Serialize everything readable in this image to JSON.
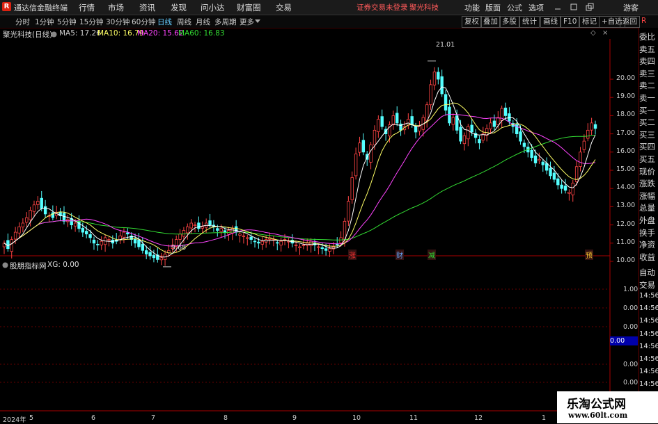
{
  "app": {
    "name": "通达信金融终端",
    "logo_char": "R",
    "warning": "证券交易未登录",
    "stock_tag": "聚光科技"
  },
  "menu": [
    "行情",
    "市场",
    "资讯",
    "发现",
    "问小达",
    "财富圈",
    "交易"
  ],
  "right_menu": [
    "功能",
    "版面",
    "公式",
    "选项"
  ],
  "login": "游客",
  "periods": [
    "分时",
    "1分钟",
    "5分钟",
    "15分钟",
    "30分钟",
    "60分钟",
    "日线",
    "周线",
    "月线",
    "多周期",
    "更多"
  ],
  "active_period": "日线",
  "tool_buttons": [
    "复权",
    "叠加",
    "多股",
    "统计",
    "画线",
    "F10",
    "标记",
    "+自选",
    "返回"
  ],
  "stock_title": "聚光科技(日线)",
  "ma": [
    {
      "label": "MA5: 17.26",
      "color": "#ffffff"
    },
    {
      "label": "MA10: 16.79",
      "color": "#ffff66"
    },
    {
      "label": "MA20: 15.62",
      "color": "#ff44ff"
    },
    {
      "label": "MA60: 16.83",
      "color": "#33dd33"
    }
  ],
  "price_axis": [
    "20.00",
    "19.00",
    "18.00",
    "17.00",
    "16.00",
    "15.00",
    "14.00",
    "13.00",
    "12.00",
    "11.00",
    "10.00"
  ],
  "high_label": "21.01",
  "low_label": "9.68",
  "markers": [
    {
      "text": "涨",
      "color": "#ff3333"
    },
    {
      "text": "财",
      "color": "#66aaff"
    },
    {
      "text": "减",
      "color": "#33dd33"
    },
    {
      "text": "预",
      "color": "#ffcc33"
    }
  ],
  "indicator": {
    "name": "股朋指标网",
    "xg": "XG: 0.00",
    "current": "0.00"
  },
  "indicator_axis": [
    "1.00",
    "0.00",
    "0.00",
    "0.00",
    "0.00"
  ],
  "side_labels": [
    "委比",
    "卖五",
    "卖四",
    "卖三",
    "卖二",
    "卖一",
    "买一",
    "买二",
    "买三",
    "买四",
    "买五",
    "现价",
    "涨跌",
    "涨幅",
    "总量",
    "外盘",
    "换手",
    "净资",
    "收益"
  ],
  "side_labels2": [
    "自动",
    "交易"
  ],
  "side_times": [
    "14:56",
    "14:56",
    "14:56",
    "14:56",
    "14:56",
    "14:56",
    "14:56",
    "14:56"
  ],
  "date_axis": [
    "2024年",
    "5",
    "6",
    "7",
    "8",
    "9",
    "10",
    "11",
    "12",
    "1"
  ],
  "watermark": {
    "line1": "乐淘公式网",
    "line2": "www.60lt.com"
  },
  "chart_data": {
    "type": "candlestick",
    "title": "聚光科技(日线)",
    "ylim": [
      9.5,
      21.3
    ],
    "high": 21.01,
    "low": 9.68,
    "ma_values": {
      "MA5": 17.26,
      "MA10": 16.79,
      "MA20": 15.62,
      "MA60": 16.83
    },
    "months": [
      "5",
      "6",
      "7",
      "8",
      "9",
      "10",
      "11",
      "12",
      "1"
    ],
    "closes": [
      11.0,
      10.7,
      11.2,
      11.6,
      11.9,
      12.1,
      12.4,
      12.8,
      13.1,
      13.3,
      12.9,
      12.6,
      12.5,
      12.4,
      12.7,
      12.5,
      12.2,
      12.3,
      12.0,
      12.1,
      11.8,
      11.6,
      11.5,
      11.3,
      11.0,
      10.9,
      11.1,
      11.3,
      11.2,
      11.0,
      11.1,
      11.4,
      11.6,
      11.5,
      11.2,
      11.0,
      10.8,
      10.6,
      10.4,
      10.3,
      10.2,
      10.1,
      10.2,
      10.4,
      10.6,
      10.9,
      11.2,
      11.5,
      11.7,
      11.9,
      12.1,
      12.0,
      11.8,
      11.9,
      12.1,
      12.0,
      11.9,
      11.7,
      11.8,
      11.6,
      11.7,
      11.8,
      11.6,
      11.5,
      11.4,
      11.3,
      11.2,
      11.1,
      11.0,
      11.1,
      11.2,
      11.3,
      11.2,
      11.0,
      11.1,
      11.2,
      11.1,
      11.0,
      10.9,
      10.8,
      10.9,
      11.0,
      11.1,
      10.9,
      10.8,
      10.7,
      10.6,
      10.7,
      10.8,
      10.9,
      11.3,
      12.2,
      13.3,
      14.6,
      15.9,
      16.5,
      16.0,
      15.6,
      16.4,
      17.2,
      17.8,
      17.4,
      17.0,
      17.5,
      18.0,
      17.6,
      17.2,
      17.4,
      17.8,
      17.5,
      17.1,
      17.4,
      17.9,
      18.6,
      19.7,
      20.4,
      20.0,
      19.2,
      18.3,
      17.6,
      17.9,
      17.2,
      16.6,
      16.9,
      17.4,
      17.1,
      16.8,
      16.5,
      17.0,
      17.3,
      17.6,
      17.4,
      17.9,
      18.4,
      18.0,
      17.7,
      17.4,
      17.0,
      16.6,
      16.3,
      16.0,
      15.7,
      15.4,
      15.6,
      15.3,
      15.0,
      14.7,
      14.5,
      14.2,
      14.0,
      13.9,
      13.8,
      14.3,
      15.2,
      16.0,
      16.6,
      17.2,
      17.6,
      17.3
    ]
  }
}
